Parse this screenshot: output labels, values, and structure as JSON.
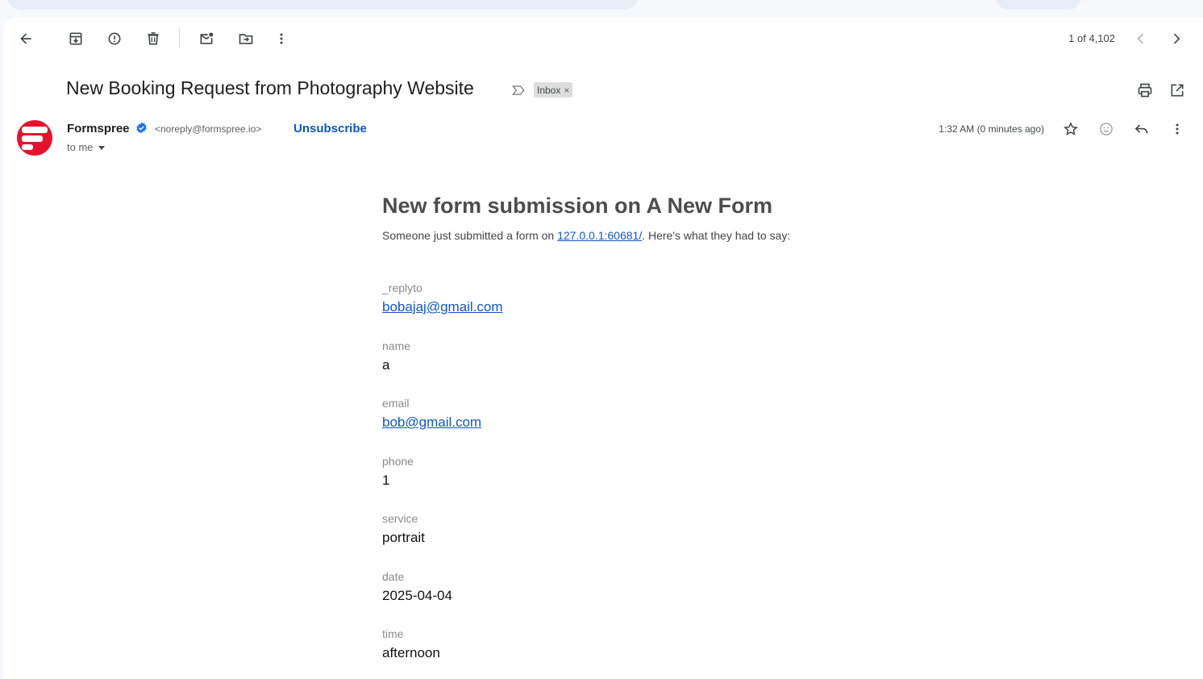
{
  "toolbar": {
    "back": "arrow-left-icon",
    "archive": "archive-icon",
    "report_spam": "report-spam-icon",
    "delete": "trash-icon",
    "mark_unread": "mark-unread-icon",
    "move_to": "move-to-icon",
    "more": "more-vertical-icon"
  },
  "pager": {
    "text": "1 of 4,102"
  },
  "email": {
    "subject": "New Booking Request from Photography Website",
    "label": "Inbox",
    "label_remove": "×",
    "sender": {
      "name": "Formspree",
      "address": "<noreply@formspree.io>",
      "unsubscribe": "Unsubscribe",
      "to": "to me"
    },
    "timestamp": "1:32 AM (0 minutes ago)"
  },
  "colors": {
    "avatar_bg": "#e5122e",
    "link": "#1155cc",
    "accent": "#0b57d0"
  },
  "message": {
    "heading": "New form submission on A New Form",
    "intro_before": "Someone just submitted a form on ",
    "intro_link": "127.0.0.1:60681/",
    "intro_after": ". Here's what they had to say:",
    "fields": [
      {
        "name": "_replyto",
        "value": "bobajaj@gmail.com",
        "link": true
      },
      {
        "name": "name",
        "value": "a",
        "link": false
      },
      {
        "name": "email",
        "value": "bob@gmail.com",
        "link": true
      },
      {
        "name": "phone",
        "value": "1",
        "link": false
      },
      {
        "name": "service",
        "value": "portrait",
        "link": false
      },
      {
        "name": "date",
        "value": "2025-04-04",
        "link": false
      },
      {
        "name": "time",
        "value": "afternoon",
        "link": false
      }
    ]
  }
}
